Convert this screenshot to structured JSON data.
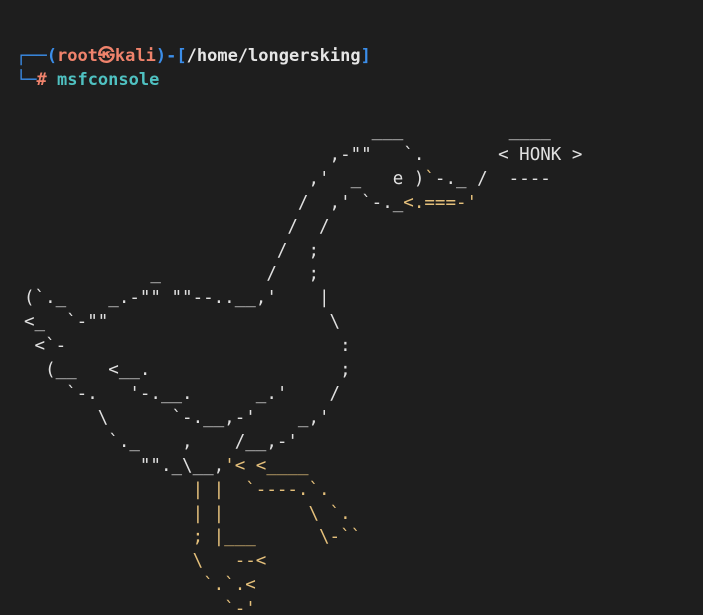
{
  "prompt": {
    "corner_top": "┌──",
    "open_paren": "(",
    "user": "root",
    "skull": "㉿",
    "host": "kali",
    "close_paren": ")",
    "dash": "-",
    "open_bracket": "[",
    "cwd": "/home/longersking",
    "close_bracket": "]",
    "corner_bottom": "└─",
    "hash": "#",
    "command": "msfconsole"
  },
  "banner": {
    "speech": "HONK",
    "lines": [
      "                                 ___          ____",
      "                             ,-\"\"   `.       < HONK >",
      "                           ,'  _   e )`-._ /  ----",
      "                          /  ,' `-._<.===-'",
      "                         /  /",
      "                        /  ;",
      "            _          /   ;",
      "(`._    _.-\"\" \"\"--..__,'    |",
      "<_  `-\"\"                     \\",
      " <`-                          :",
      "  (__   <__.                  ;",
      "    `-.   '-.__.      _.'    /",
      "       \\      `-.__,-'    _,'",
      "        `._    ,    /__,-'",
      "           \"\"._\\__,'< <____",
      "                | |  `----.`.",
      "                | |        \\ `.",
      "                ; |___      \\-``",
      "                \\   --<",
      "                 `.`.<",
      "                   `-'"
    ]
  }
}
